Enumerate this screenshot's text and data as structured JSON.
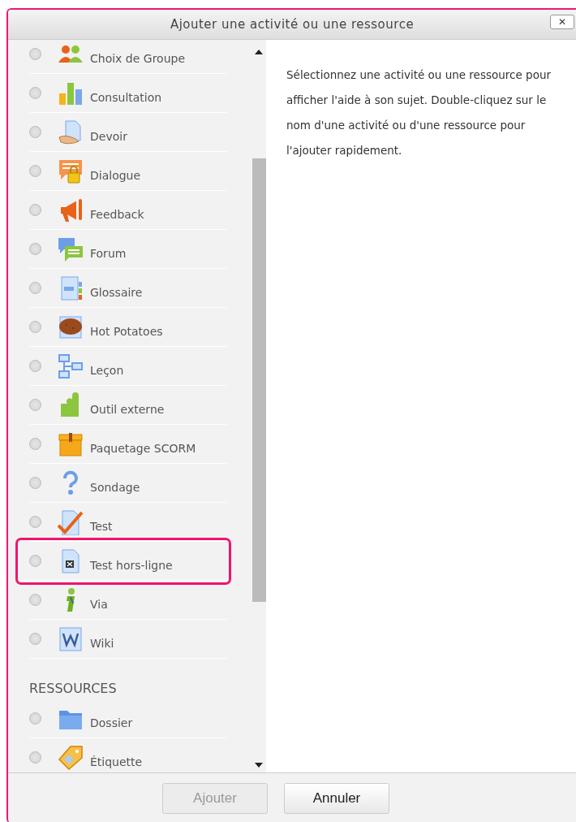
{
  "window": {
    "title": "Ajouter une activité ou une ressource",
    "close": "✕"
  },
  "sections": [
    {
      "items": [
        {
          "label": "Choix de Groupe",
          "selected": false,
          "highlighted": false
        },
        {
          "label": "Consultation",
          "selected": false,
          "highlighted": false
        },
        {
          "label": "Devoir",
          "selected": false,
          "highlighted": false
        },
        {
          "label": "Dialogue",
          "selected": false,
          "highlighted": false
        },
        {
          "label": "Feedback",
          "selected": false,
          "highlighted": false
        },
        {
          "label": "Forum",
          "selected": false,
          "highlighted": false
        },
        {
          "label": "Glossaire",
          "selected": false,
          "highlighted": false
        },
        {
          "label": "Hot Potatoes",
          "selected": false,
          "highlighted": false
        },
        {
          "label": "Leçon",
          "selected": false,
          "highlighted": false
        },
        {
          "label": "Outil externe",
          "selected": false,
          "highlighted": false
        },
        {
          "label": "Paquetage SCORM",
          "selected": false,
          "highlighted": false
        },
        {
          "label": "Sondage",
          "selected": false,
          "highlighted": false
        },
        {
          "label": "Test",
          "selected": false,
          "highlighted": false
        },
        {
          "label": "Test hors-ligne",
          "selected": false,
          "highlighted": true
        },
        {
          "label": "Via",
          "selected": false,
          "highlighted": false
        },
        {
          "label": "Wiki",
          "selected": false,
          "highlighted": false
        }
      ]
    },
    {
      "heading": "RESSOURCES",
      "items": [
        {
          "label": "Dossier",
          "selected": false,
          "highlighted": false
        },
        {
          "label": "Étiquette",
          "selected": false,
          "highlighted": false
        }
      ]
    }
  ],
  "help_text": "Sélectionnez une activité ou une ressource pour afficher l'aide à son sujet. Double-cliquez sur le nom d'une activité ou d'une ressource pour l'ajouter rapidement.",
  "buttons": [
    {
      "label": "Ajouter",
      "disabled": true
    },
    {
      "label": "Annuler",
      "disabled": false
    }
  ]
}
